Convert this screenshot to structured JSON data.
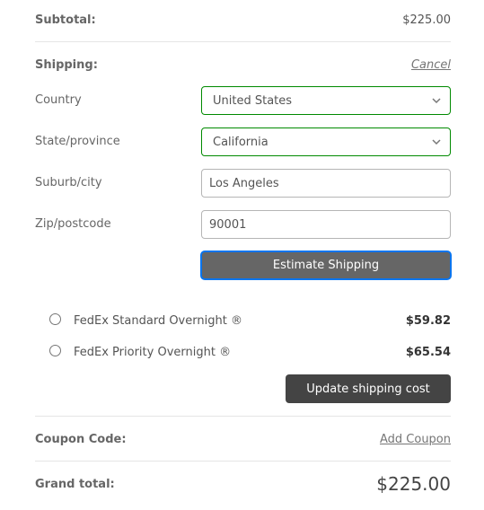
{
  "subtotal": {
    "label": "Subtotal:",
    "value": "$225.00"
  },
  "shipping": {
    "label": "Shipping:",
    "cancel_label": "Cancel",
    "fields": {
      "country": {
        "label": "Country",
        "value": "United States"
      },
      "state": {
        "label": "State/province",
        "value": "California"
      },
      "city": {
        "label": "Suburb/city",
        "value": "Los Angeles"
      },
      "zip": {
        "label": "Zip/postcode",
        "value": "90001"
      }
    },
    "estimate_button": "Estimate Shipping",
    "options": [
      {
        "label": "FedEx Standard Overnight ®",
        "price": "$59.82",
        "selected": false
      },
      {
        "label": "FedEx Priority Overnight ®",
        "price": "$65.54",
        "selected": false
      }
    ],
    "update_button": "Update shipping cost"
  },
  "coupon": {
    "label": "Coupon Code:",
    "link": "Add Coupon"
  },
  "grand_total": {
    "label": "Grand total:",
    "value": "$225.00"
  },
  "colors": {
    "select_border": "#008a00",
    "focus_ring": "#0a75ee",
    "estimate_bg": "#666666",
    "update_bg": "#444444"
  }
}
